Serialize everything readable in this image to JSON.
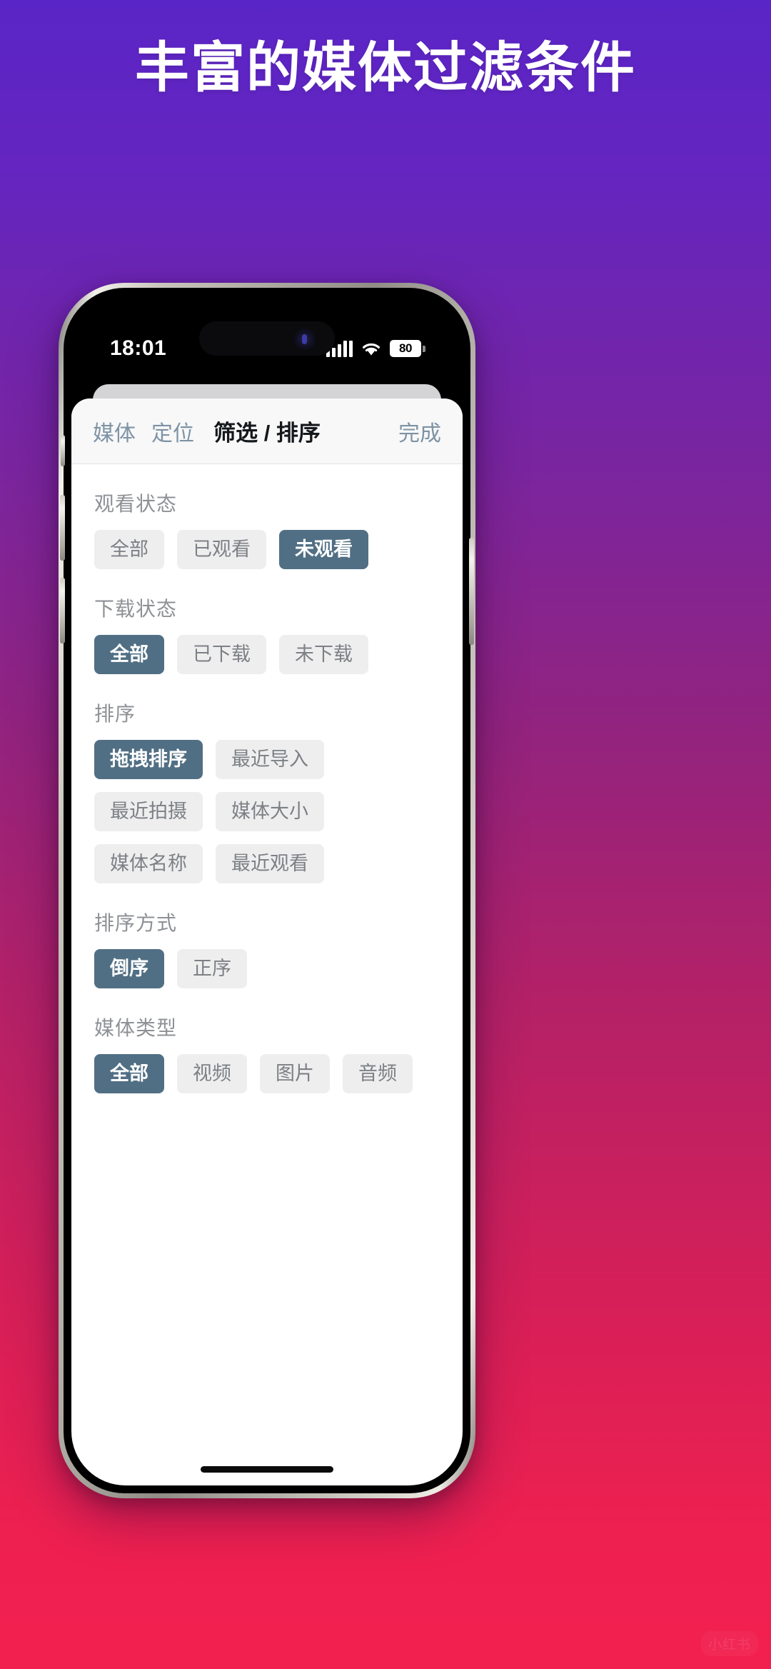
{
  "headline": "丰富的媒体过滤条件",
  "watermark": "小红书",
  "theme": {
    "gradient_top": "#5a25c6",
    "gradient_bottom": "#f2204f",
    "accent_selected": "#516f84",
    "chip_bg": "#eeeeef",
    "chip_text": "#7d8084",
    "nav_link": "#7e93a4"
  },
  "status_bar": {
    "time": "18:01",
    "signal_icon": "cellular-bars-icon",
    "wifi_icon": "wifi-icon",
    "battery_level": "80",
    "battery_icon": "battery-icon"
  },
  "nav": {
    "back_label": "媒体",
    "back_secondary_label": "定位",
    "title": "筛选 / 排序",
    "done_label": "完成"
  },
  "sections": [
    {
      "title": "观看状态",
      "options": [
        {
          "label": "全部",
          "selected": false
        },
        {
          "label": "已观看",
          "selected": false
        },
        {
          "label": "未观看",
          "selected": true
        }
      ]
    },
    {
      "title": "下载状态",
      "options": [
        {
          "label": "全部",
          "selected": true
        },
        {
          "label": "已下载",
          "selected": false
        },
        {
          "label": "未下载",
          "selected": false
        }
      ]
    },
    {
      "title": "排序",
      "options": [
        {
          "label": "拖拽排序",
          "selected": true
        },
        {
          "label": "最近导入",
          "selected": false
        },
        {
          "label": "最近拍摄",
          "selected": false
        },
        {
          "label": "媒体大小",
          "selected": false
        },
        {
          "label": "媒体名称",
          "selected": false
        },
        {
          "label": "最近观看",
          "selected": false
        }
      ]
    },
    {
      "title": "排序方式",
      "options": [
        {
          "label": "倒序",
          "selected": true
        },
        {
          "label": "正序",
          "selected": false
        }
      ]
    },
    {
      "title": "媒体类型",
      "options": [
        {
          "label": "全部",
          "selected": true
        },
        {
          "label": "视频",
          "selected": false
        },
        {
          "label": "图片",
          "selected": false
        },
        {
          "label": "音频",
          "selected": false
        }
      ]
    }
  ]
}
